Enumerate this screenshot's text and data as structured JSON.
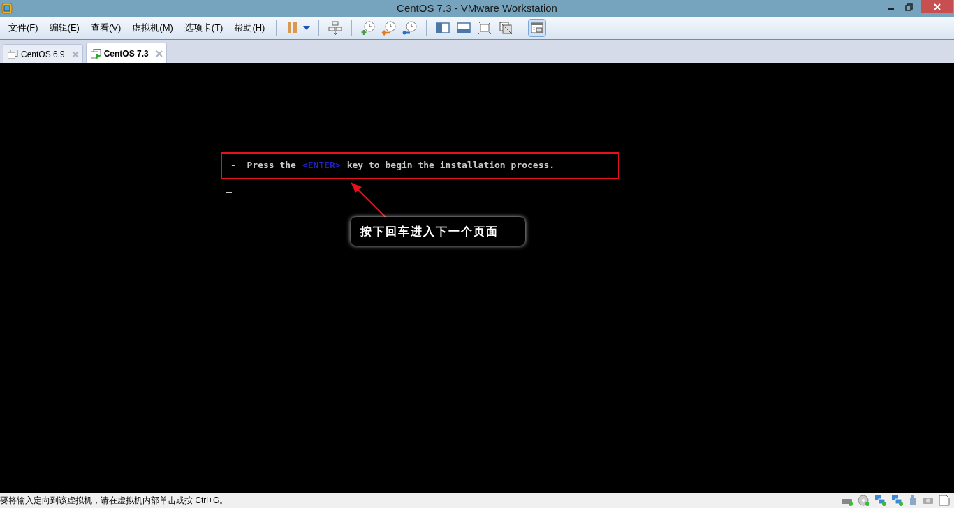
{
  "window": {
    "title": "CentOS 7.3 - VMware Workstation"
  },
  "menu": [
    "文件(F)",
    "编辑(E)",
    "查看(V)",
    "虚拟机(M)",
    "选项卡(T)",
    "帮助(H)"
  ],
  "tabs": [
    {
      "label": "CentOS 6.9",
      "selected": false,
      "running": false
    },
    {
      "label": "CentOS 7.3",
      "selected": true,
      "running": true
    }
  ],
  "console": {
    "prefix": "-  Press the",
    "key": "<ENTER>",
    "suffix": "key to begin the installation process.",
    "annotation": "按下回车进入下一个页面"
  },
  "status_bar": {
    "message": "要将输入定向到该虚拟机，请在虚拟机内部单击或按 Ctrl+G。"
  }
}
